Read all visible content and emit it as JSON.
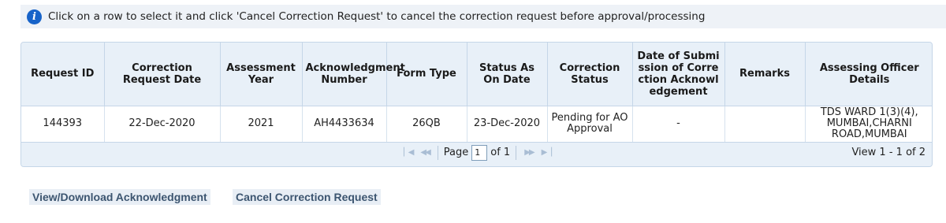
{
  "info": {
    "icon": "info-icon",
    "text": "Click on a row to select it and click 'Cancel Correction Request' to cancel the correction request before approval/processing"
  },
  "grid": {
    "columns": [
      "Request ID",
      "Correction Request Date",
      "Assessment Year",
      "Acknowledgment Number",
      "Form Type",
      "Status As On Date",
      "Correction Status",
      "Date of Submission of Correction Acknowledgement",
      "Remarks",
      "Assessing Officer Details"
    ],
    "rows": [
      {
        "request_id": "144393",
        "correction_request_date": "22-Dec-2020",
        "assessment_year": "2021",
        "acknowledgment_number": "AH4433634",
        "form_type": "26QB",
        "status_as_on_date": "23-Dec-2020",
        "correction_status": "Pending for AO Approval",
        "date_of_submission": "-",
        "remarks": "",
        "assessing_officer": "TDS WARD 1(3)(4), MUMBAI,CHARNI ROAD,MUMBAI"
      }
    ]
  },
  "pager": {
    "page_label": "Page",
    "page_value": "1",
    "of_label": "of 1",
    "view_text": "View 1 - 1 of 2"
  },
  "buttons": {
    "view_download": "View/Download Acknowledgment",
    "cancel_request": "Cancel Correction Request"
  }
}
